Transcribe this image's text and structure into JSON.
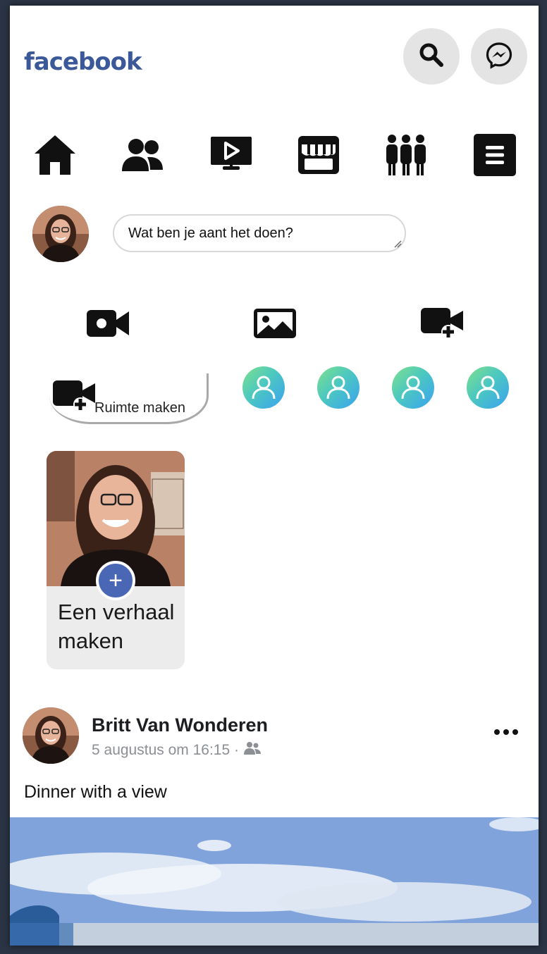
{
  "header": {
    "logo": "facebook",
    "search_icon": "search-icon",
    "messenger_icon": "messenger-icon"
  },
  "nav": {
    "items": [
      {
        "icon": "home-icon"
      },
      {
        "icon": "friends-icon"
      },
      {
        "icon": "watch-icon"
      },
      {
        "icon": "marketplace-icon"
      },
      {
        "icon": "groups-icon"
      },
      {
        "icon": "menu-icon"
      }
    ]
  },
  "composer": {
    "placeholder": "Wat ben je aant het doen?"
  },
  "actions": {
    "items": [
      {
        "icon": "live-video-icon"
      },
      {
        "icon": "photo-icon"
      },
      {
        "icon": "create-room-icon"
      }
    ]
  },
  "rooms": {
    "create_label": "Ruimte maken",
    "friends_count": 4
  },
  "story": {
    "create_label": "Een verhaal maken",
    "plus": "+"
  },
  "post": {
    "author": "Britt Van Wonderen",
    "timestamp": "5 augustus om 16:15 ·",
    "text": "Dinner with a view"
  },
  "colors": {
    "brand": "#3b5998",
    "plus_button": "#4a67b6",
    "background": "#2b3444"
  }
}
